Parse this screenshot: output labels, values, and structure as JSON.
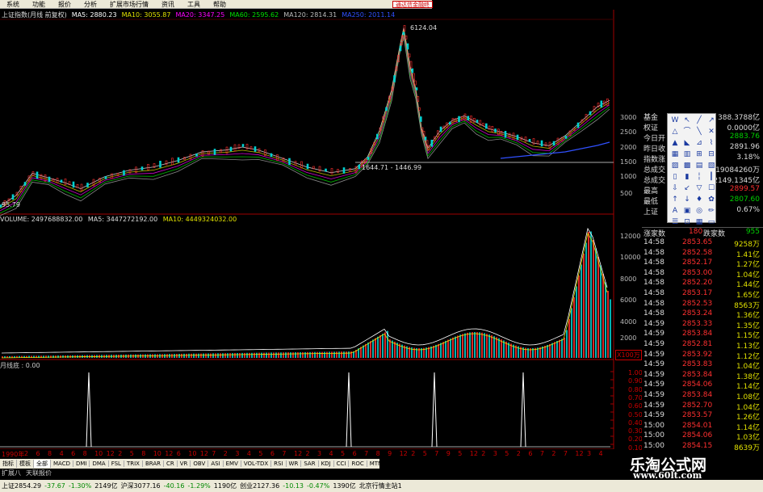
{
  "menubar": {
    "items": [
      "系统",
      "功能",
      "报价",
      "分析",
      "扩展市场行情",
      "资讯",
      "工具",
      "帮助"
    ],
    "ad": "通达信金融终"
  },
  "price_header": {
    "title": "上证指数(月线 前复权)",
    "ma5": "MA5: 2880.23",
    "ma10": "MA10: 3055.87",
    "ma20": "MA20: 3347.25",
    "ma60": "MA60: 2595.62",
    "ma120": "MA120: 2814.31",
    "ma250": "MA250: 2011.14",
    "colors": {
      "ma5": "#ffffff",
      "ma10": "#e0e000",
      "ma20": "#ff00ff",
      "ma60": "#00e000",
      "ma120": "#aaaaaa",
      "ma250": "#3050ff"
    }
  },
  "price_labels": {
    "peak": "6124.04",
    "low": "1644.71 - 1446.99",
    "base": "95.79"
  },
  "price_axis": [
    "3000",
    "2500",
    "2000",
    "1500",
    "1000",
    "500"
  ],
  "volume_header": {
    "volume": "VOLUME: 2497688832.00",
    "ma5": "MA5: 3447272192.00",
    "ma10": "MA10: 4449324032.00"
  },
  "volume_axis": [
    "12000",
    "10000",
    "8000",
    "6000",
    "4000",
    "2000"
  ],
  "volume_unit": "X100万",
  "osc_header": "月线底 : 0.00",
  "osc_axis": [
    "1.00",
    "0.90",
    "0.80",
    "0.70",
    "0.60",
    "0.50",
    "0.40",
    "0.30",
    "0.20",
    "0.10"
  ],
  "stats": [
    {
      "k": "基金",
      "v": "388.3788亿",
      "color": "#dddddd"
    },
    {
      "k": "权证",
      "v": "0.0000亿",
      "color": "#dddddd"
    },
    {
      "k": "今日开",
      "v": "2883.76",
      "color": "#00d000"
    },
    {
      "k": "昨日收",
      "v": "2891.96",
      "color": "#dddddd"
    },
    {
      "k": "指数涨",
      "v": "3.18%",
      "color": "#dddddd"
    },
    {
      "k": "总成交",
      "v": "19084260万",
      "color": "#dddddd"
    },
    {
      "k": "总成交",
      "v": "2149.1345亿",
      "color": "#dddddd"
    },
    {
      "k": "最高",
      "v": "2899.57",
      "color": "#ff3030"
    },
    {
      "k": "最低",
      "v": "2807.60",
      "color": "#00d000"
    },
    {
      "k": "上证",
      "v": "0.67%",
      "color": "#dddddd"
    }
  ],
  "counter": {
    "up_label": "涨家数",
    "up": "180",
    "down_label": "跌家数",
    "down": "955"
  },
  "ticks": [
    {
      "t": "14:58",
      "p": "2853.65",
      "v": "9258万"
    },
    {
      "t": "14:58",
      "p": "2852.58",
      "v": "1.41亿"
    },
    {
      "t": "14:58",
      "p": "2852.17",
      "v": "1.27亿"
    },
    {
      "t": "14:58",
      "p": "2853.00",
      "v": "1.04亿"
    },
    {
      "t": "14:58",
      "p": "2852.20",
      "v": "1.44亿"
    },
    {
      "t": "14:58",
      "p": "2853.17",
      "v": "1.65亿"
    },
    {
      "t": "14:58",
      "p": "2852.53",
      "v": "8563万"
    },
    {
      "t": "14:58",
      "p": "2853.24",
      "v": "1.36亿"
    },
    {
      "t": "14:59",
      "p": "2853.33",
      "v": "1.35亿"
    },
    {
      "t": "14:59",
      "p": "2853.84",
      "v": "1.15亿"
    },
    {
      "t": "14:59",
      "p": "2852.81",
      "v": "1.13亿"
    },
    {
      "t": "14:59",
      "p": "2853.92",
      "v": "1.12亿"
    },
    {
      "t": "14:59",
      "p": "2853.83",
      "v": "1.04亿"
    },
    {
      "t": "14:59",
      "p": "2853.84",
      "v": "1.38亿"
    },
    {
      "t": "14:59",
      "p": "2854.06",
      "v": "1.14亿"
    },
    {
      "t": "14:59",
      "p": "2853.84",
      "v": "1.08亿"
    },
    {
      "t": "14:59",
      "p": "2852.70",
      "v": "1.04亿"
    },
    {
      "t": "14:59",
      "p": "2853.57",
      "v": "1.26亿"
    },
    {
      "t": "15:00",
      "p": "2854.01",
      "v": "1.14亿"
    },
    {
      "t": "15:00",
      "p": "2854.06",
      "v": "1.03亿"
    },
    {
      "t": "15:00",
      "p": "2854.15",
      "v": "8639万"
    }
  ],
  "date_axis": [
    "1990年",
    "2",
    "6",
    "8",
    "4",
    "6",
    "8",
    "10",
    "12",
    "2",
    "5",
    "8",
    "10",
    "12",
    "6",
    "10",
    "12",
    "7",
    "2",
    "3",
    "4",
    "5",
    "6",
    "7",
    "12",
    "2",
    "3",
    "4",
    "5",
    "6",
    "7",
    "8",
    "9",
    "12",
    "2",
    "5",
    "7",
    "9",
    "5",
    "12",
    "2",
    "3",
    "5",
    "2",
    "6",
    "7",
    "2",
    "7",
    "12",
    "3",
    "4"
  ],
  "indicator_tabs": [
    "指标",
    "模板",
    "全部",
    "MACD",
    "DMI",
    "DMA",
    "FSL",
    "TRIX",
    "BRAR",
    "CR",
    "VR",
    "OBV",
    "ASI",
    "EMV",
    "VOL-TDX",
    "RSI",
    "WR",
    "SAR",
    "KDJ",
    "CCI",
    "ROC",
    "MTM",
    "BOLL",
    "PSY",
    "MCST"
  ],
  "active_tab": 2,
  "expand_row": [
    "扩展八",
    "天联报价"
  ],
  "statusbar": [
    {
      "text": "上证2854.29",
      "cls": ""
    },
    {
      "text": "-37.67",
      "cls": "green"
    },
    {
      "text": "-1.30%",
      "cls": "green"
    },
    {
      "text": "2149亿",
      "cls": ""
    },
    {
      "text": "沪深3077.16",
      "cls": ""
    },
    {
      "text": "-40.16",
      "cls": "green"
    },
    {
      "text": "-1.29%",
      "cls": "green"
    },
    {
      "text": "1190亿",
      "cls": ""
    },
    {
      "text": "创业2127.36",
      "cls": ""
    },
    {
      "text": "-10.13",
      "cls": "green"
    },
    {
      "text": "-0.47%",
      "cls": "green"
    },
    {
      "text": "1390亿",
      "cls": ""
    },
    {
      "text": "北京行情主站1",
      "cls": ""
    }
  ],
  "tools": [
    "W",
    "↖",
    "╱",
    "↗",
    "△",
    "⌒",
    "╲",
    "✕",
    "▲",
    "◣",
    "⊿",
    "⌇",
    "▦",
    "▥",
    "⊞",
    "⊟",
    "▨",
    "▩",
    "▤",
    "▧",
    "▯",
    "▮",
    "╎",
    "┃",
    "⇩",
    "↙",
    "▽",
    "☐",
    "↑",
    "↓",
    "♦",
    "✿",
    "A",
    "▣",
    "◎",
    "✏",
    "☰",
    "⊡",
    "▦",
    "▭"
  ],
  "watermark": {
    "cn": "乐淘公式网",
    "url": "www.60lt.com"
  }
}
